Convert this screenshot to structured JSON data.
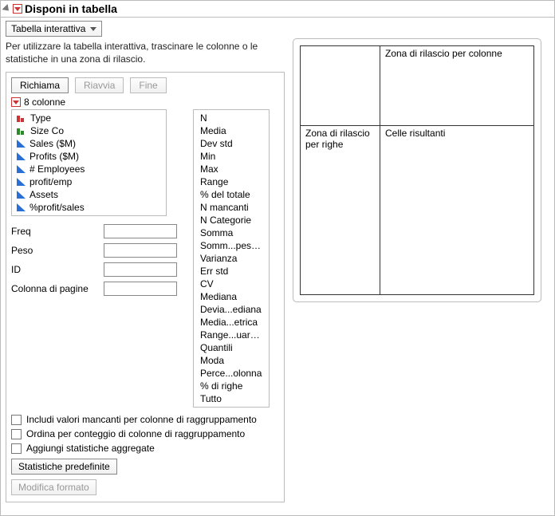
{
  "header": {
    "title": "Disponi in tabella"
  },
  "dropdown": {
    "label": "Tabella interattiva"
  },
  "helptext": "Per utilizzare la tabella interattiva, trascinare le colonne o le statistiche in una zona di rilascio.",
  "buttons": {
    "recall": "Richiama",
    "restart": "Riavvia",
    "finish": "Fine",
    "defaults": "Statistiche predefinite",
    "edit_format": "Modifica formato"
  },
  "columns_label": "8 colonne",
  "columns": [
    {
      "name": "Type",
      "icon": "bars-red"
    },
    {
      "name": "Size Co",
      "icon": "bars-green"
    },
    {
      "name": "Sales ($M)",
      "icon": "tri-blue"
    },
    {
      "name": "Profits ($M)",
      "icon": "tri-blue"
    },
    {
      "name": "# Employees",
      "icon": "tri-blue"
    },
    {
      "name": "profit/emp",
      "icon": "tri-blue"
    },
    {
      "name": "Assets",
      "icon": "tri-blue"
    },
    {
      "name": "%profit/sales",
      "icon": "tri-blue"
    }
  ],
  "stats": [
    "N",
    "Media",
    "Dev std",
    "Min",
    "Max",
    "Range",
    "% del totale",
    "N mancanti",
    "N Categorie",
    "Somma",
    "Somm...pesata",
    "Varianza",
    "Err std",
    "CV",
    "Mediana",
    "Devia...ediana",
    "Media...etrica",
    "Range...uartile",
    "Quantili",
    "Moda",
    "Perce...olonna",
    "% di righe",
    "Tutto"
  ],
  "fields": {
    "freq": "Freq",
    "peso": "Peso",
    "id": "ID",
    "page_col": "Colonna di pagine"
  },
  "checks": {
    "missing": "Includi valori mancanti per colonne di raggruppamento",
    "order": "Ordina per conteggio di colonne di raggruppamento",
    "aggregate": "Aggiungi statistiche aggregate"
  },
  "dropzones": {
    "cols": "Zona di rilascio per colonne",
    "rows": "Zona di rilascio per righe",
    "cells": "Celle risultanti"
  }
}
